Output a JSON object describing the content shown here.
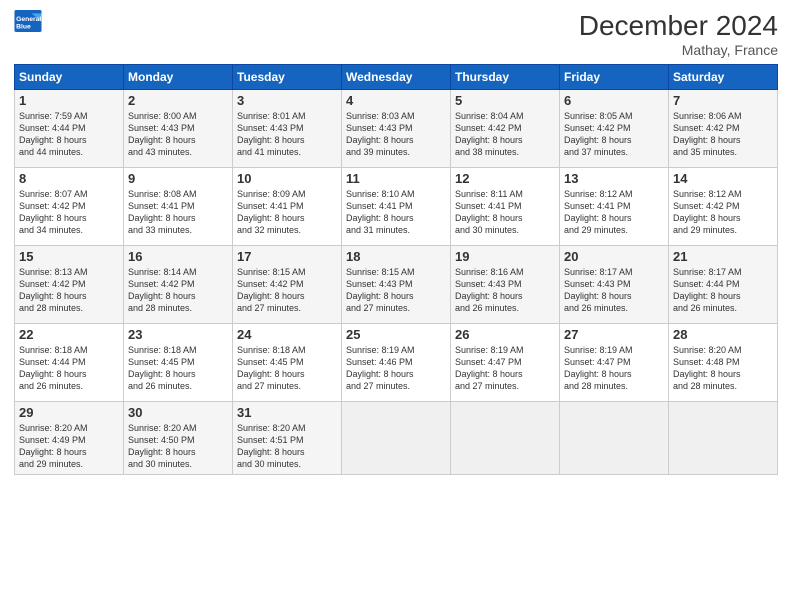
{
  "header": {
    "logo_line1": "General",
    "logo_line2": "Blue",
    "month": "December 2024",
    "location": "Mathay, France"
  },
  "days_of_week": [
    "Sunday",
    "Monday",
    "Tuesday",
    "Wednesday",
    "Thursday",
    "Friday",
    "Saturday"
  ],
  "weeks": [
    [
      {
        "day": "1",
        "lines": [
          "Sunrise: 7:59 AM",
          "Sunset: 4:44 PM",
          "Daylight: 8 hours",
          "and 44 minutes."
        ]
      },
      {
        "day": "2",
        "lines": [
          "Sunrise: 8:00 AM",
          "Sunset: 4:43 PM",
          "Daylight: 8 hours",
          "and 43 minutes."
        ]
      },
      {
        "day": "3",
        "lines": [
          "Sunrise: 8:01 AM",
          "Sunset: 4:43 PM",
          "Daylight: 8 hours",
          "and 41 minutes."
        ]
      },
      {
        "day": "4",
        "lines": [
          "Sunrise: 8:03 AM",
          "Sunset: 4:43 PM",
          "Daylight: 8 hours",
          "and 39 minutes."
        ]
      },
      {
        "day": "5",
        "lines": [
          "Sunrise: 8:04 AM",
          "Sunset: 4:42 PM",
          "Daylight: 8 hours",
          "and 38 minutes."
        ]
      },
      {
        "day": "6",
        "lines": [
          "Sunrise: 8:05 AM",
          "Sunset: 4:42 PM",
          "Daylight: 8 hours",
          "and 37 minutes."
        ]
      },
      {
        "day": "7",
        "lines": [
          "Sunrise: 8:06 AM",
          "Sunset: 4:42 PM",
          "Daylight: 8 hours",
          "and 35 minutes."
        ]
      }
    ],
    [
      {
        "day": "8",
        "lines": [
          "Sunrise: 8:07 AM",
          "Sunset: 4:42 PM",
          "Daylight: 8 hours",
          "and 34 minutes."
        ]
      },
      {
        "day": "9",
        "lines": [
          "Sunrise: 8:08 AM",
          "Sunset: 4:41 PM",
          "Daylight: 8 hours",
          "and 33 minutes."
        ]
      },
      {
        "day": "10",
        "lines": [
          "Sunrise: 8:09 AM",
          "Sunset: 4:41 PM",
          "Daylight: 8 hours",
          "and 32 minutes."
        ]
      },
      {
        "day": "11",
        "lines": [
          "Sunrise: 8:10 AM",
          "Sunset: 4:41 PM",
          "Daylight: 8 hours",
          "and 31 minutes."
        ]
      },
      {
        "day": "12",
        "lines": [
          "Sunrise: 8:11 AM",
          "Sunset: 4:41 PM",
          "Daylight: 8 hours",
          "and 30 minutes."
        ]
      },
      {
        "day": "13",
        "lines": [
          "Sunrise: 8:12 AM",
          "Sunset: 4:41 PM",
          "Daylight: 8 hours",
          "and 29 minutes."
        ]
      },
      {
        "day": "14",
        "lines": [
          "Sunrise: 8:12 AM",
          "Sunset: 4:42 PM",
          "Daylight: 8 hours",
          "and 29 minutes."
        ]
      }
    ],
    [
      {
        "day": "15",
        "lines": [
          "Sunrise: 8:13 AM",
          "Sunset: 4:42 PM",
          "Daylight: 8 hours",
          "and 28 minutes."
        ]
      },
      {
        "day": "16",
        "lines": [
          "Sunrise: 8:14 AM",
          "Sunset: 4:42 PM",
          "Daylight: 8 hours",
          "and 28 minutes."
        ]
      },
      {
        "day": "17",
        "lines": [
          "Sunrise: 8:15 AM",
          "Sunset: 4:42 PM",
          "Daylight: 8 hours",
          "and 27 minutes."
        ]
      },
      {
        "day": "18",
        "lines": [
          "Sunrise: 8:15 AM",
          "Sunset: 4:43 PM",
          "Daylight: 8 hours",
          "and 27 minutes."
        ]
      },
      {
        "day": "19",
        "lines": [
          "Sunrise: 8:16 AM",
          "Sunset: 4:43 PM",
          "Daylight: 8 hours",
          "and 26 minutes."
        ]
      },
      {
        "day": "20",
        "lines": [
          "Sunrise: 8:17 AM",
          "Sunset: 4:43 PM",
          "Daylight: 8 hours",
          "and 26 minutes."
        ]
      },
      {
        "day": "21",
        "lines": [
          "Sunrise: 8:17 AM",
          "Sunset: 4:44 PM",
          "Daylight: 8 hours",
          "and 26 minutes."
        ]
      }
    ],
    [
      {
        "day": "22",
        "lines": [
          "Sunrise: 8:18 AM",
          "Sunset: 4:44 PM",
          "Daylight: 8 hours",
          "and 26 minutes."
        ]
      },
      {
        "day": "23",
        "lines": [
          "Sunrise: 8:18 AM",
          "Sunset: 4:45 PM",
          "Daylight: 8 hours",
          "and 26 minutes."
        ]
      },
      {
        "day": "24",
        "lines": [
          "Sunrise: 8:18 AM",
          "Sunset: 4:45 PM",
          "Daylight: 8 hours",
          "and 27 minutes."
        ]
      },
      {
        "day": "25",
        "lines": [
          "Sunrise: 8:19 AM",
          "Sunset: 4:46 PM",
          "Daylight: 8 hours",
          "and 27 minutes."
        ]
      },
      {
        "day": "26",
        "lines": [
          "Sunrise: 8:19 AM",
          "Sunset: 4:47 PM",
          "Daylight: 8 hours",
          "and 27 minutes."
        ]
      },
      {
        "day": "27",
        "lines": [
          "Sunrise: 8:19 AM",
          "Sunset: 4:47 PM",
          "Daylight: 8 hours",
          "and 28 minutes."
        ]
      },
      {
        "day": "28",
        "lines": [
          "Sunrise: 8:20 AM",
          "Sunset: 4:48 PM",
          "Daylight: 8 hours",
          "and 28 minutes."
        ]
      }
    ],
    [
      {
        "day": "29",
        "lines": [
          "Sunrise: 8:20 AM",
          "Sunset: 4:49 PM",
          "Daylight: 8 hours",
          "and 29 minutes."
        ]
      },
      {
        "day": "30",
        "lines": [
          "Sunrise: 8:20 AM",
          "Sunset: 4:50 PM",
          "Daylight: 8 hours",
          "and 30 minutes."
        ]
      },
      {
        "day": "31",
        "lines": [
          "Sunrise: 8:20 AM",
          "Sunset: 4:51 PM",
          "Daylight: 8 hours",
          "and 30 minutes."
        ]
      },
      {
        "day": "",
        "lines": []
      },
      {
        "day": "",
        "lines": []
      },
      {
        "day": "",
        "lines": []
      },
      {
        "day": "",
        "lines": []
      }
    ]
  ]
}
